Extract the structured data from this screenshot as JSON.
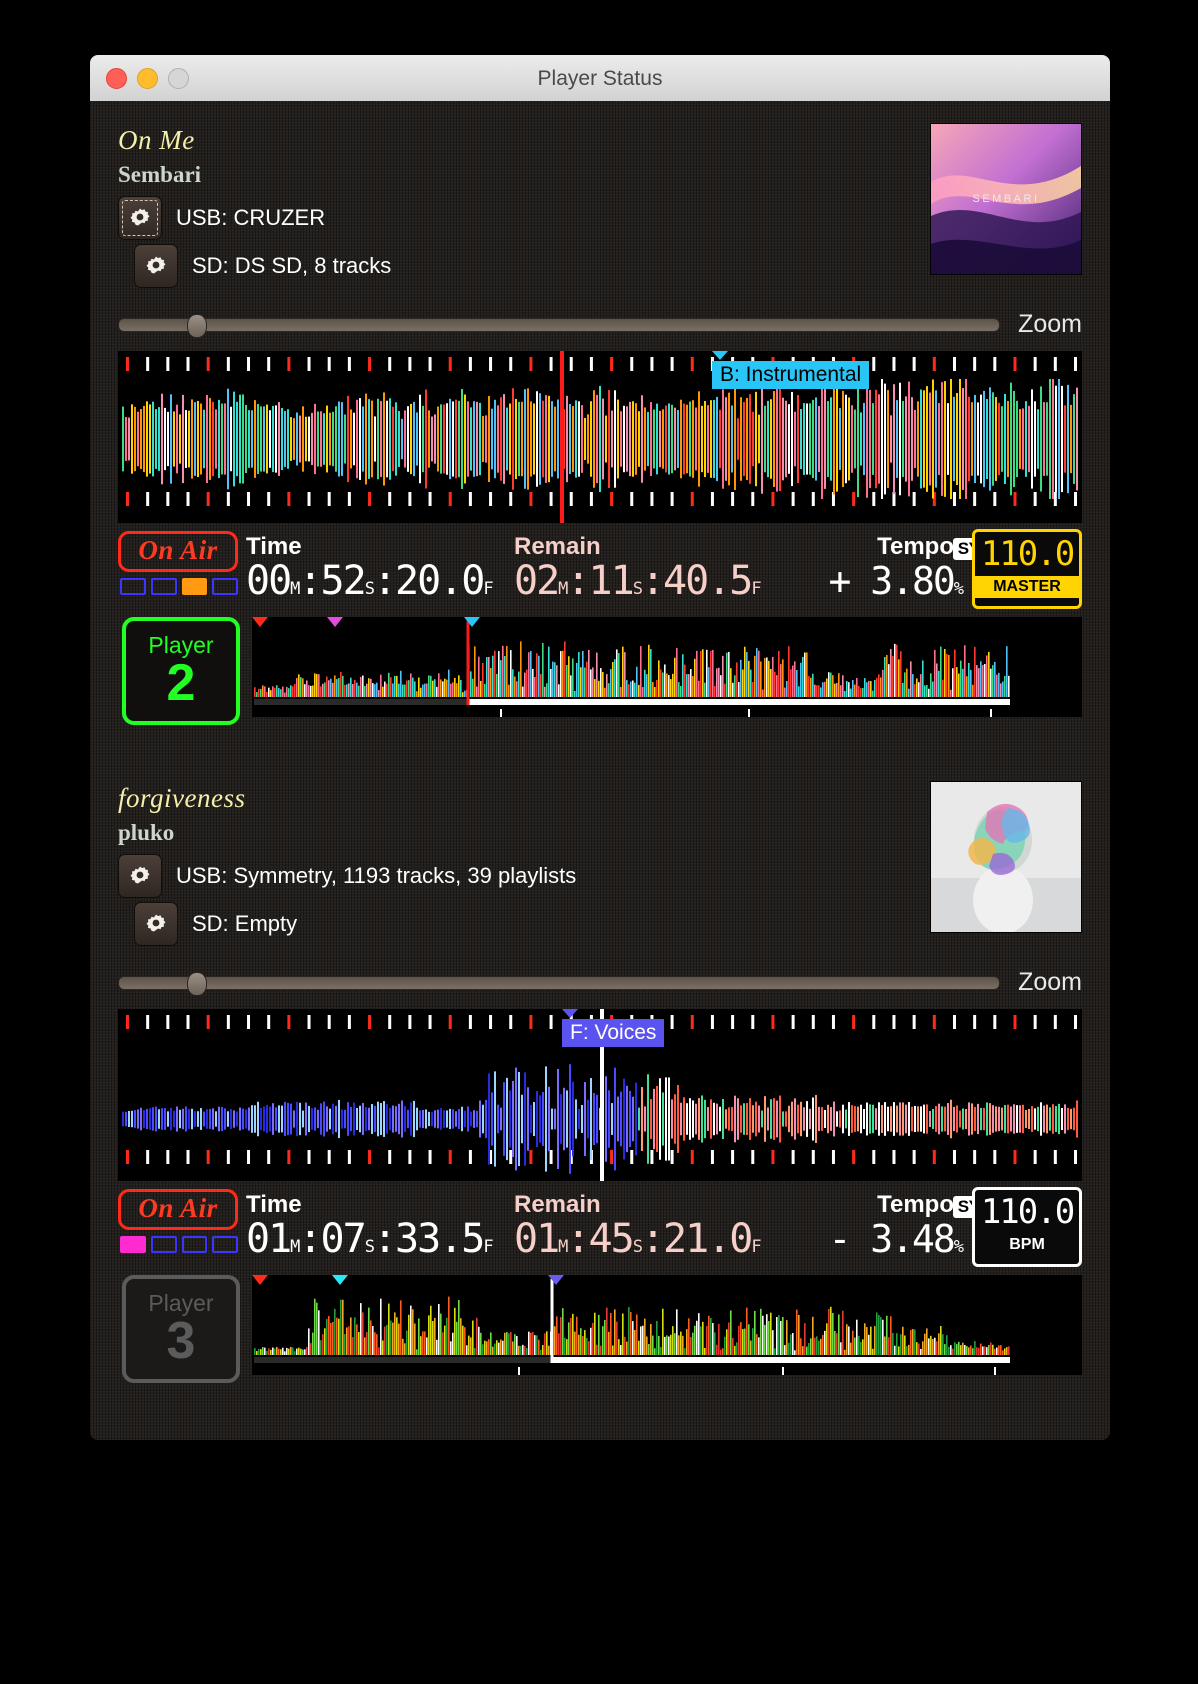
{
  "window": {
    "title": "Player Status",
    "traffic_lights": [
      "close",
      "minimize",
      "zoom"
    ]
  },
  "decks": [
    {
      "track_title": "On Me",
      "artist": "Sembari",
      "artwork_label": "SEMBARI",
      "usb": {
        "icon": "gear-icon",
        "label": "USB: CRUZER",
        "focused": true
      },
      "sd": {
        "icon": "gear-icon",
        "label": "SD: DS SD, 8 tracks",
        "focused": false
      },
      "zoom_label": "Zoom",
      "zoom_value": 8,
      "phrase": {
        "text": "B: Instrumental",
        "color": "#29c5f6",
        "left_pct": 61.5
      },
      "on_air": "On Air",
      "on_air_active": true,
      "beats": [
        0,
        0,
        1,
        0
      ],
      "beat_color": "#ff9a12",
      "time_label": "Time",
      "time_value": "00:52:20.0",
      "time_parts": {
        "h": "00",
        "m": "52",
        "s": "20.0",
        "u1": "M",
        "u2": "S",
        "u3": "F"
      },
      "remain_label": "Remain",
      "remain_value": "02:11:40.5",
      "remain_parts": {
        "h": "02",
        "m": "11",
        "s": "40.5",
        "u1": "M",
        "u2": "S",
        "u3": "F"
      },
      "tempo_label": "Tempo",
      "sync_label": "SYNC",
      "tempo_value": "+ 3.80",
      "tempo_unit": "%",
      "bpm_value": "110.0",
      "bpm_tag": "MASTER",
      "bpm_is_master": true,
      "player_word": "Player",
      "player_number": "2",
      "player_active": true
    },
    {
      "track_title": "forgiveness",
      "artist": "pluko",
      "artwork_label": "",
      "usb": {
        "icon": "gear-icon",
        "label": "USB: Symmetry, 1193 tracks, 39 playlists",
        "focused": false
      },
      "sd": {
        "icon": "gear-icon",
        "label": "SD: Empty",
        "focused": false
      },
      "zoom_label": "Zoom",
      "zoom_value": 8,
      "phrase": {
        "text": "F: Voices",
        "color": "#5b53ef",
        "left_pct": 50.2
      },
      "on_air": "On Air",
      "on_air_active": true,
      "beats": [
        1,
        0,
        0,
        0
      ],
      "beat_color": "#ff2bd0",
      "time_label": "Time",
      "time_value": "01:07:33.5",
      "time_parts": {
        "h": "01",
        "m": "07",
        "s": "33.5",
        "u1": "M",
        "u2": "S",
        "u3": "F"
      },
      "remain_label": "Remain",
      "remain_value": "01:45:21.0",
      "remain_parts": {
        "h": "01",
        "m": "45",
        "s": "21.0",
        "u1": "M",
        "u2": "S",
        "u3": "F"
      },
      "tempo_label": "Tempo",
      "sync_label": "SYNC",
      "tempo_value": "- 3.48",
      "tempo_unit": "%",
      "bpm_value": "110.0",
      "bpm_tag": "BPM",
      "bpm_is_master": false,
      "player_word": "Player",
      "player_number": "3",
      "player_active": false
    }
  ],
  "colors": {
    "accent_yellow": "#ffd400",
    "on_air_red": "#ff2a1a",
    "player_green": "#22ff22",
    "title_yellow": "#f2f0ab",
    "artist_grey": "#cdd6cd"
  }
}
